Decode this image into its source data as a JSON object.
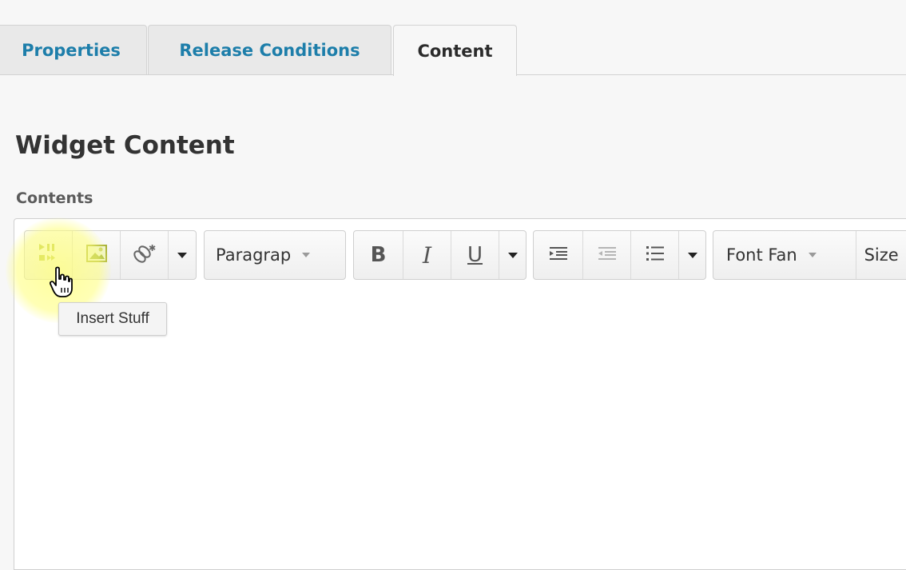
{
  "tabs": [
    {
      "label": "Properties"
    },
    {
      "label": "Release Conditions"
    },
    {
      "label": "Content",
      "active": true
    }
  ],
  "page": {
    "title": "Widget Content",
    "field_label": "Contents"
  },
  "toolbar": {
    "insert_group": [
      "insert-stuff-icon",
      "insert-image-icon",
      "insert-link-icon"
    ],
    "format_select": "Paragrap",
    "text_style": {
      "bold": "B",
      "italic": "I",
      "underline": "U"
    },
    "list_group": [
      "indent-icon",
      "outdent-icon",
      "bullet-list-icon"
    ],
    "font_family_select": "Font Fan",
    "size_select": "Size"
  },
  "tooltip": {
    "text": "Insert Stuff"
  },
  "colors": {
    "tab_link": "#1d7eaa",
    "insert_icon": "#b6c23e",
    "highlight": "#ffff78"
  }
}
